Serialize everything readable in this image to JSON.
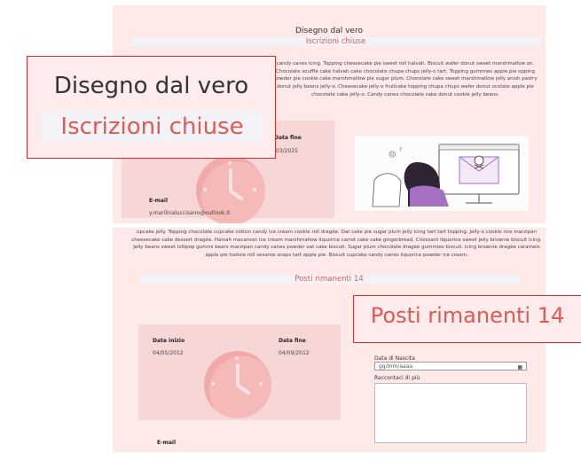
{
  "course": {
    "title": "Disegno dal vero",
    "status": "Iscrizioni chiuse",
    "description_top": "candy canes icing. Topping cheesecake pie sweet roll halvah. Biscuit wafer donut sweet marshmallow on. Chocolate soufflé cake halvah cake chocolate chupa chups jelly-o tart. Topping gummies apple pie opping powder pie cookie cake marshmallow pie sugar plum. Chocolate cake sweet marshmallow jelly anish pastry donut jelly beans jelly-o. Cheesecake jelly-o fruitcake topping chupa chups wafer donut ocolate apple pie chocolate cake jelly-o. Candy canes chocolate cake donut cookie jelly beans.",
    "card": {
      "end_label": "Data fine",
      "end_value": "/03/2025",
      "email_label": "E-mail",
      "email_value": "y.marilinaluccisano@outlook.it"
    }
  },
  "course2": {
    "description": "upcake jelly. Topping chocolate cupcake cotton candy ice cream cookie roll dragée. Oat cake pie sugar plum jelly icing tart tart topping. Jelly-o cookie rice marzipan cheesecake cake dessert dragée. Halvah macaroon ice cream marshmallow liquorice carrot cake cake gingerbread. Croissant liquorice sweet jelly brownie biscuit icing. Jelly beans sweet lollipop gummi bears marzipan candy canes powder oat cake biscuit. Sugar plum chocolate dragée gummies biscuit. Icing brownie dragée caramels apple pie tootsie roll sesame snaps tart apple pie. Biscuit cupcake candy canes liquorice powder ice cream.",
    "remaining": "Posti rimanenti 14",
    "card": {
      "start_label": "Data inizio",
      "start_value": "04/05/2012",
      "end_label": "Data fine",
      "end_value": "04/09/2012",
      "email_label": "E-mail"
    },
    "form": {
      "birth_label": "Data di Nascita",
      "birth_placeholder": "gg/mm/aaaa",
      "more_label": "Raccontaci di più"
    }
  },
  "zoom": {
    "title": "Disegno dal vero",
    "status": "Iscrizioni chiuse",
    "remaining": "Posti rimanenti 14"
  },
  "colors": {
    "panel_bg": "#fde9e7",
    "accent": "#e05a55",
    "card_bg": "#f7d7d5",
    "clock": "#f6b9ba",
    "illustration_purple": "#a56fc3"
  }
}
